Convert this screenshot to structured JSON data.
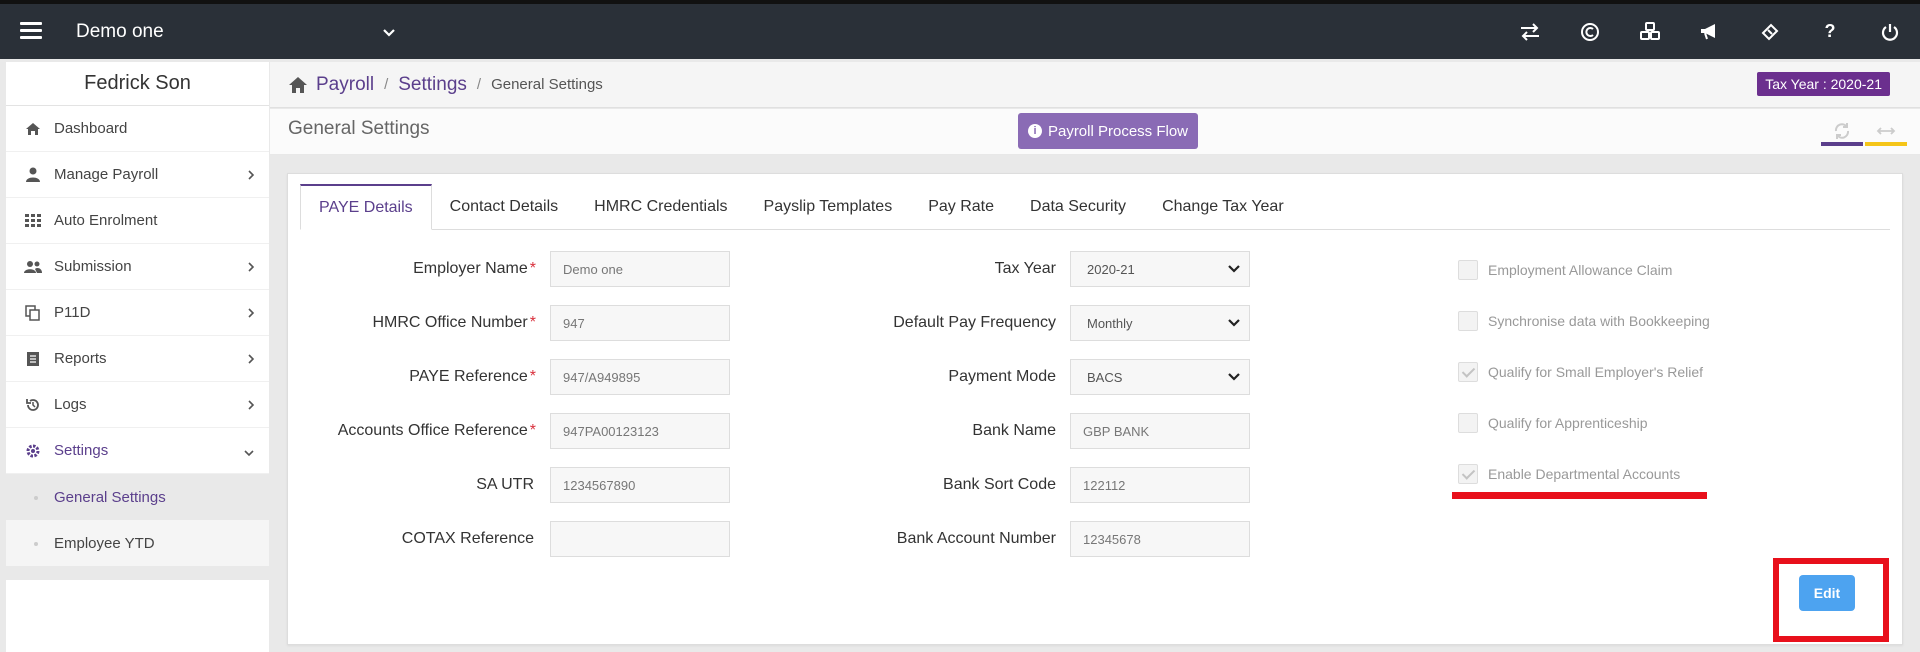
{
  "topbar": {
    "company_name": "Demo one",
    "icons": [
      "swap-icon",
      "currency-icon",
      "modules-icon",
      "announcement-icon",
      "ticket-icon",
      "help-icon",
      "power-icon"
    ]
  },
  "sidebar": {
    "user_name": "Fedrick Son",
    "items": [
      {
        "label": "Dashboard",
        "icon": "home-icon"
      },
      {
        "label": "Manage Payroll",
        "icon": "user-icon"
      },
      {
        "label": "Auto Enrolment",
        "icon": "grid-icon"
      },
      {
        "label": "Submission",
        "icon": "users-icon"
      },
      {
        "label": "P11D",
        "icon": "copy-icon"
      },
      {
        "label": "Reports",
        "icon": "document-icon"
      },
      {
        "label": "Logs",
        "icon": "history-icon"
      },
      {
        "label": "Settings",
        "icon": "gear-icon"
      }
    ],
    "sub_items": [
      {
        "label": "General Settings"
      },
      {
        "label": "Employee YTD"
      }
    ]
  },
  "breadcrumb": {
    "items": [
      "Payroll",
      "Settings",
      "General Settings"
    ],
    "tax_year_badge": "Tax Year : 2020-21"
  },
  "page": {
    "title": "General Settings",
    "flow_button": "Payroll Process Flow"
  },
  "tabs": [
    "PAYE Details",
    "Contact Details",
    "HMRC Credentials",
    "Payslip Templates",
    "Pay Rate",
    "Data Security",
    "Change Tax Year"
  ],
  "left_fields": [
    {
      "label": "Employer Name",
      "value": "Demo one",
      "required": "*"
    },
    {
      "label": "HMRC Office Number",
      "value": "947",
      "required": "*"
    },
    {
      "label": "PAYE Reference",
      "value": "947/A949895",
      "required": "*"
    },
    {
      "label": "Accounts Office Reference",
      "value": "947PA00123123",
      "required": "*"
    },
    {
      "label": "SA UTR",
      "value": "1234567890",
      "required": ""
    },
    {
      "label": "COTAX Reference",
      "value": "",
      "required": ""
    }
  ],
  "middle_fields": [
    {
      "label": "Tax Year",
      "value": "2020-21"
    },
    {
      "label": "Default Pay Frequency",
      "value": "Monthly"
    },
    {
      "label": "Payment Mode",
      "value": "BACS"
    },
    {
      "label": "Bank Name",
      "value": "GBP BANK"
    },
    {
      "label": "Bank Sort Code",
      "value": "122112"
    },
    {
      "label": "Bank Account Number",
      "value": "12345678"
    }
  ],
  "checkboxes": [
    {
      "label": "Employment Allowance Claim",
      "checked": false
    },
    {
      "label": "Synchronise data with Bookkeeping",
      "checked": false
    },
    {
      "label": "Qualify for Small Employer's Relief",
      "checked": true
    },
    {
      "label": "Qualify for Apprenticeship",
      "checked": false
    },
    {
      "label": "Enable Departmental Accounts",
      "checked": true
    }
  ],
  "edit_button": "Edit",
  "colors": {
    "topbar": "#2a3038",
    "accent_purple": "#5b3f8c",
    "badge": "#6b2f8e",
    "flow_button": "#8a6bb5",
    "edit_button": "#4da3f0",
    "highlight_red": "#e8101b",
    "required": "#d9303c"
  }
}
